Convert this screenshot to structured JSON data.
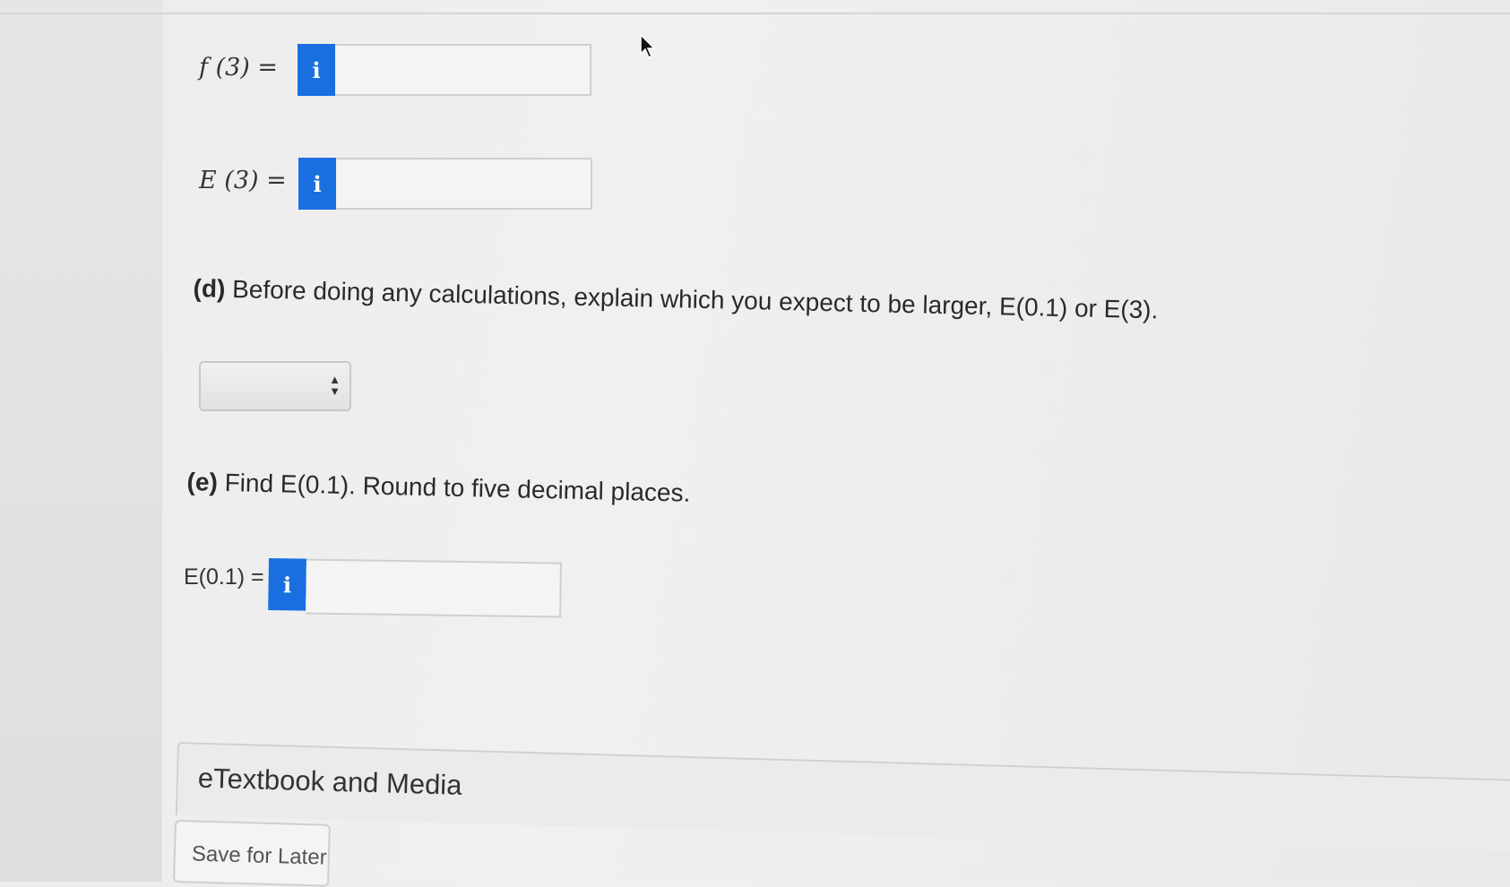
{
  "part_c": {
    "f3_label": "f (3) =",
    "E3_label": "E (3) =",
    "info_icon": "i"
  },
  "part_d": {
    "letter": "(d)",
    "text": "Before doing any calculations, explain which you expect to be larger, E(0.1) or E(3).",
    "select_value": ""
  },
  "part_e": {
    "letter": "(e)",
    "text": "Find E(0.1). Round to five decimal places.",
    "E01_label": "E(0.1) =",
    "info_icon": "i"
  },
  "footer": {
    "etextbook_label": "eTextbook and Media",
    "save_label": "Save for Later"
  },
  "colors": {
    "info_button": "#1a6fe0"
  }
}
